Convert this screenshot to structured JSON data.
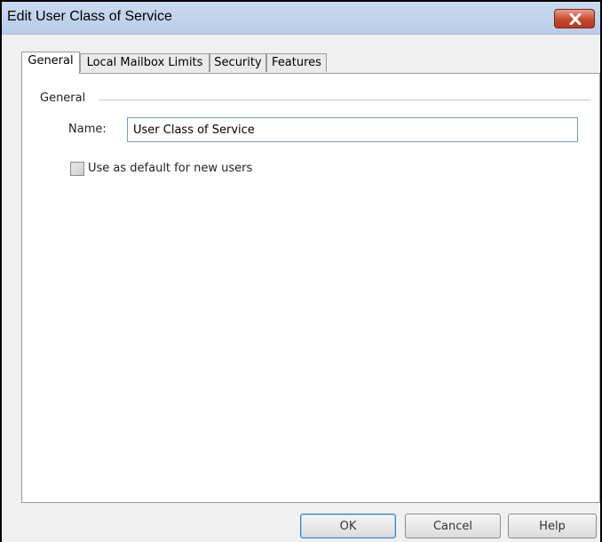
{
  "window": {
    "title": "Edit User Class of Service"
  },
  "tabs": [
    {
      "label": "General"
    },
    {
      "label": "Local Mailbox Limits"
    },
    {
      "label": "Security"
    },
    {
      "label": "Features"
    }
  ],
  "general": {
    "group_label": "General",
    "name_label": "Name:",
    "name_value": "User Class of Service",
    "default_checkbox_label": "Use as default for new users",
    "default_checkbox_checked": false
  },
  "buttons": {
    "ok": "OK",
    "cancel": "Cancel",
    "help": "Help"
  },
  "icons": {
    "close": "close-icon"
  }
}
